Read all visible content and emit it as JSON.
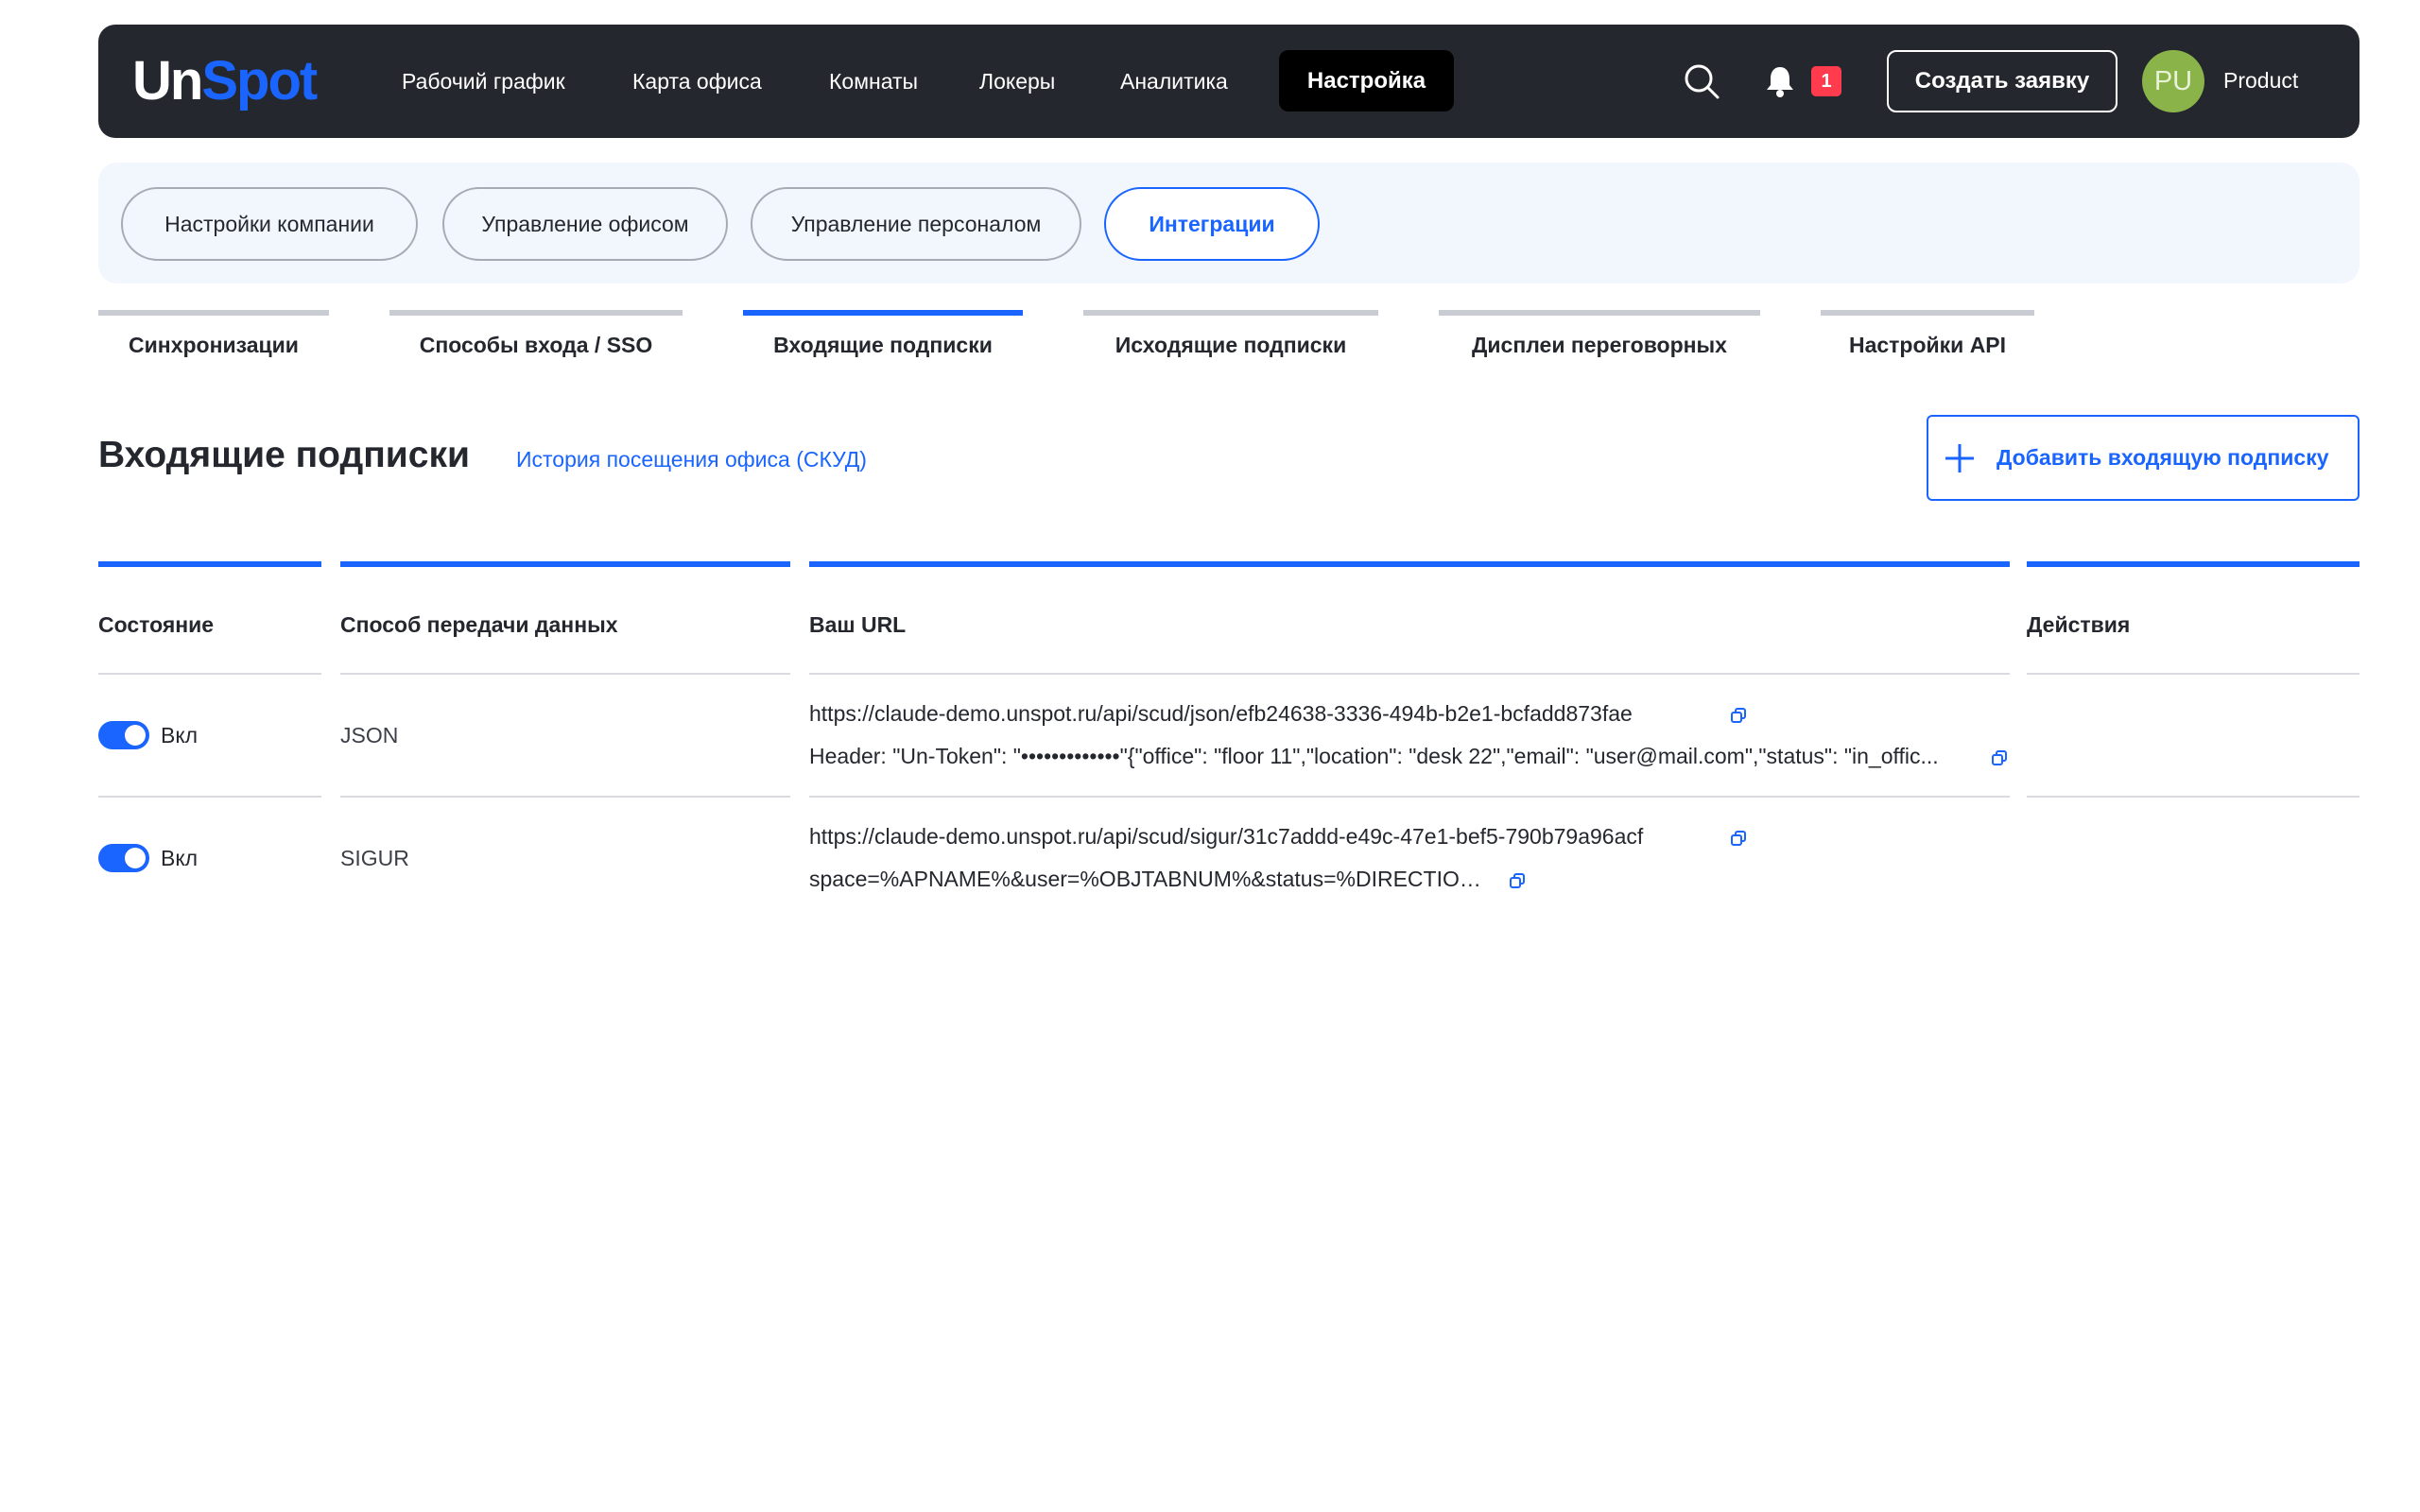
{
  "brand": {
    "logo_part1": "Un",
    "logo_part2": "Spot"
  },
  "nav": {
    "items": [
      "Рабочий график",
      "Карта офиса",
      "Комнаты",
      "Локеры",
      "Аналитика"
    ],
    "active": "Настройка",
    "notification_count": "1",
    "create_button": "Создать заявку",
    "user_initials": "PU",
    "user_name": "Product"
  },
  "settings_tabs": {
    "items": [
      "Настройки компании",
      "Управление офисом",
      "Управление персоналом",
      "Интеграции"
    ],
    "active_index": 3
  },
  "sub_tabs": {
    "items": [
      "Синхронизации",
      "Способы входа / SSO",
      "Входящие подписки",
      "Исходящие подписки",
      "Дисплеи переговорных",
      "Настройки API"
    ],
    "active_index": 2
  },
  "section": {
    "title": "Входящие подписки",
    "history_link": "История посещения офиса (СКУД)",
    "add_button": "Добавить входящую подписку"
  },
  "table": {
    "headers": [
      "Состояние",
      "Способ передачи данных",
      "Ваш URL",
      "Действия"
    ],
    "rows": [
      {
        "state": "Вкл",
        "enabled": true,
        "method": "JSON",
        "url": "https://claude-demo.unspot.ru/api/scud/json/efb24638-3336-494b-b2e1-bcfadd873fae",
        "extra": "Header: \"Un-Token\": \"•••••••••••••\"{\"office\": \"floor 11\",\"location\": \"desk 22\",\"email\": \"user@mail.com\",\"status\": \"in_offic..."
      },
      {
        "state": "Вкл",
        "enabled": true,
        "method": "SIGUR",
        "url": "https://claude-demo.unspot.ru/api/scud/sigur/31c7addd-e49c-47e1-bef5-790b79a96acf",
        "extra": "space=%APNAME%&user=%OBJTABNUM%&status=%DIRECTION%"
      }
    ]
  },
  "colors": {
    "navbar_bg": "#25272e",
    "accent": "#1a64ff",
    "badge": "#ff3b4d",
    "avatar": "#8ab34a",
    "pillbar_bg": "#f2f6fd"
  }
}
